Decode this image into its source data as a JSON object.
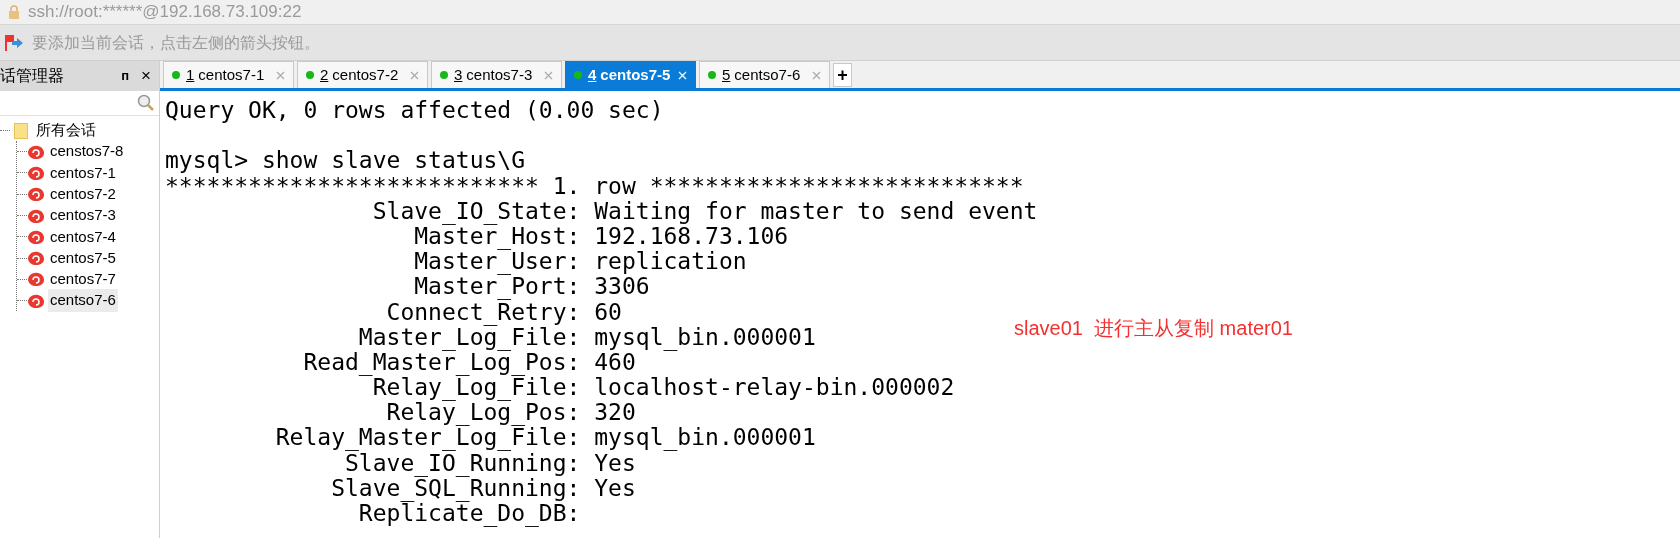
{
  "window": {
    "title": "ssh://root:******@192.168.73.109:22"
  },
  "toolbar": {
    "message": "要添加当前会话，点击左侧的箭头按钮。"
  },
  "sidebar": {
    "title": "话管理器",
    "pin": "ᴨ",
    "close": "×",
    "tree": {
      "label": "所有会话",
      "children": [
        {
          "label": "censtos7-8",
          "selected": false
        },
        {
          "label": "centos7-1",
          "selected": false
        },
        {
          "label": "centos7-2",
          "selected": false
        },
        {
          "label": "centos7-3",
          "selected": false
        },
        {
          "label": "centos7-4",
          "selected": false
        },
        {
          "label": "centos7-5",
          "selected": false
        },
        {
          "label": "centos7-7",
          "selected": false
        },
        {
          "label": "centso7-6",
          "selected": true
        }
      ]
    }
  },
  "tabs": [
    {
      "number": "1",
      "label": "centos7-1",
      "selected": false
    },
    {
      "number": "2",
      "label": "centos7-2",
      "selected": false
    },
    {
      "number": "3",
      "label": "centos7-3",
      "selected": false
    },
    {
      "number": "4",
      "label": "centos7-5",
      "selected": true
    },
    {
      "number": "5",
      "label": "centso7-6",
      "selected": false
    }
  ],
  "new_tab": "+",
  "terminal": {
    "lines": [
      "Query OK, 0 rows affected (0.00 sec)",
      "mysql> show slave status\\G",
      "*************************** 1. row ***************************",
      "               Slave_IO_State: Waiting for master to send event",
      "                  Master_Host: 192.168.73.106",
      "                  Master_User: replication",
      "                  Master_Port: 3306",
      "                Connect_Retry: 60",
      "              Master_Log_File: mysql_bin.000001",
      "          Read_Master_Log_Pos: 460",
      "               Relay_Log_File: localhost-relay-bin.000002",
      "                Relay_Log_Pos: 320",
      "        Relay_Master_Log_File: mysql_bin.000001",
      "             Slave_IO_Running: Yes",
      "            Slave_SQL_Running: Yes",
      "              Replicate_Do_DB:"
    ],
    "blank_after_first": true,
    "annotation": "slave01  进行主从复制 mater01"
  }
}
